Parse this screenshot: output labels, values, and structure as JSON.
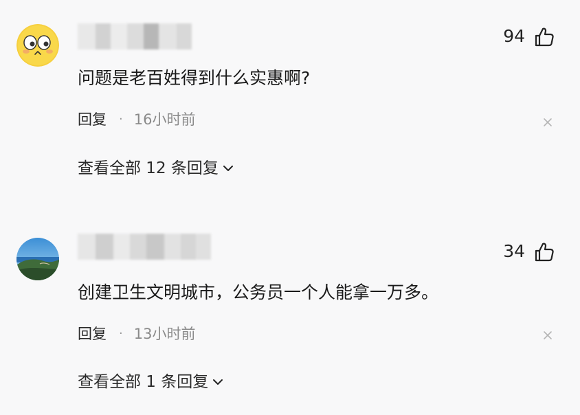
{
  "comments": [
    {
      "likes": "94",
      "text": "问题是老百姓得到什么实惠啊?",
      "reply_label": "回复",
      "separator": "·",
      "time": "16小时前",
      "view_replies": "查看全部 12 条回复"
    },
    {
      "likes": "34",
      "text": "创建卫生文明城市，公务员一个人能拿一万多。",
      "reply_label": "回复",
      "separator": "·",
      "time": "13小时前",
      "view_replies": "查看全部 1 条回复"
    }
  ],
  "icons": {
    "like": "thumbs-up-icon",
    "close": "close-icon",
    "expand": "chevron-down-icon"
  }
}
